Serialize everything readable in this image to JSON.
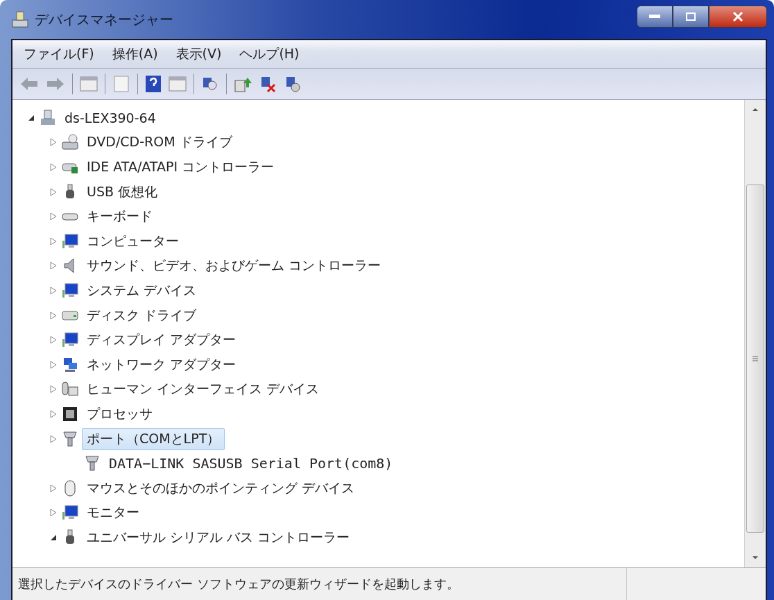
{
  "window": {
    "title": "デバイスマネージャー"
  },
  "menu": [
    "ファイル(F)",
    "操作(A)",
    "表示(V)",
    "ヘルプ(H)"
  ],
  "tree": [
    {
      "label": "ds-LEX390-64",
      "kind": "computer-root",
      "expanded": true,
      "selected": false,
      "children": [
        {
          "label": "DVD/CD-ROM ドライブ",
          "kind": "drive",
          "expanded": false,
          "selected": false
        },
        {
          "label": "IDE ATA/ATAPI コントローラー",
          "kind": "controller",
          "expanded": false,
          "selected": false
        },
        {
          "label": "USB 仮想化",
          "kind": "usb",
          "expanded": false,
          "selected": false
        },
        {
          "label": "キーボード",
          "kind": "keyboard",
          "expanded": false,
          "selected": false
        },
        {
          "label": "コンピューター",
          "kind": "monitor",
          "expanded": false,
          "selected": false
        },
        {
          "label": "サウンド、ビデオ、およびゲーム コントローラー",
          "kind": "speaker",
          "expanded": false,
          "selected": false
        },
        {
          "label": "システム デバイス",
          "kind": "monitor",
          "expanded": false,
          "selected": false
        },
        {
          "label": "ディスク ドライブ",
          "kind": "disk",
          "expanded": false,
          "selected": false
        },
        {
          "label": "ディスプレイ アダプター",
          "kind": "monitor",
          "expanded": false,
          "selected": false
        },
        {
          "label": "ネットワーク アダプター",
          "kind": "network",
          "expanded": false,
          "selected": false
        },
        {
          "label": "ヒューマン インターフェイス デバイス",
          "kind": "hid",
          "expanded": false,
          "selected": false
        },
        {
          "label": "プロセッサ",
          "kind": "chip",
          "expanded": false,
          "selected": false
        },
        {
          "label": "ポート（COMとLPT）",
          "kind": "port",
          "expanded": false,
          "selected": true,
          "children": [
            {
              "label": "DATA−LINK SASUSB Serial Port(com8)",
              "kind": "port",
              "selected": false
            }
          ]
        },
        {
          "label": "マウスとそのほかのポインティング デバイス",
          "kind": "mouse",
          "expanded": false,
          "selected": false
        },
        {
          "label": "モニター",
          "kind": "monitor",
          "expanded": false,
          "selected": false
        },
        {
          "label": "ユニバーサル シリアル バス コントローラー",
          "kind": "usb",
          "expanded": true,
          "selected": false
        }
      ]
    }
  ],
  "status_bar": "選択したデバイスのドライバー ソフトウェアの更新ウィザードを起動します。"
}
